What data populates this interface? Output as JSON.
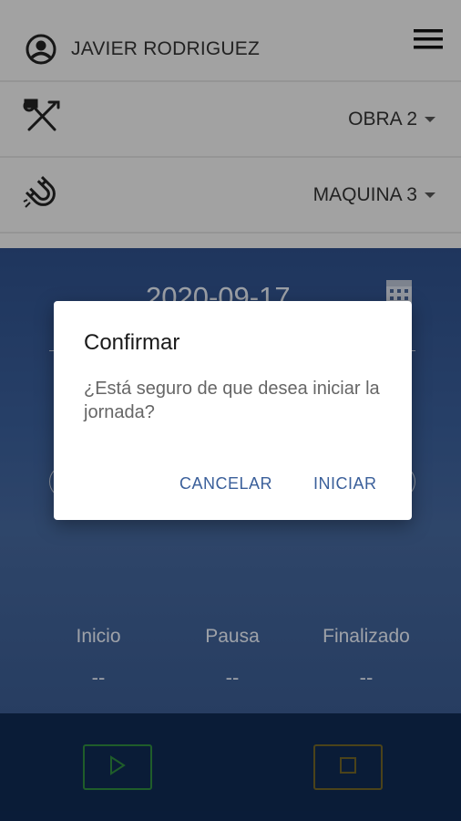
{
  "header": {
    "user_name": "JAVIER RODRIGUEZ",
    "obra": "OBRA 2",
    "maquina": "MAQUINA 3"
  },
  "main": {
    "date": "2020-09-17",
    "stats": [
      {
        "label": "Inicio",
        "value": "--"
      },
      {
        "label": "Pausa",
        "value": "--"
      },
      {
        "label": "Finalizado",
        "value": "--"
      }
    ]
  },
  "dialog": {
    "title": "Confirmar",
    "message": "¿Está seguro de que desea iniciar la jornada?",
    "cancel_label": "CANCELAR",
    "confirm_label": "INICIAR"
  },
  "colors": {
    "accent": "#3a5f9a",
    "play": "#2f8a3f",
    "stop": "#6f6427"
  },
  "icons": [
    "user-circle-icon",
    "hamburger-menu-icon",
    "tools-icon",
    "magnet-icon",
    "calendar-icon",
    "play-icon",
    "stop-icon"
  ]
}
